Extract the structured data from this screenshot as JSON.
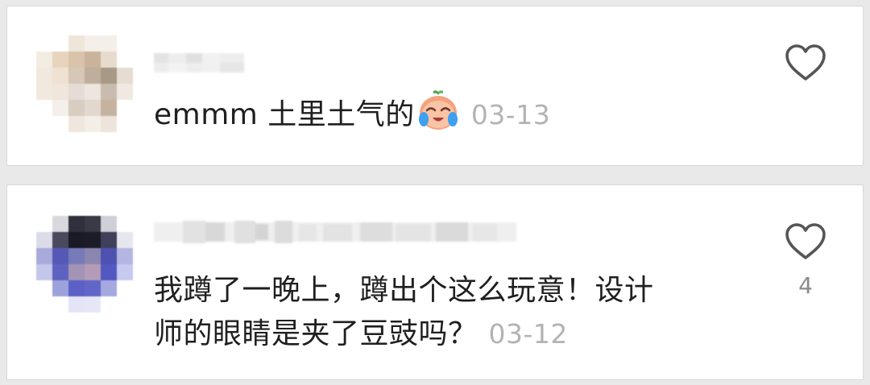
{
  "comments": [
    {
      "text": "emmm 土里土气的",
      "emoji": "crying-laughing-face-emoji",
      "date": "03-13",
      "like_count": ""
    },
    {
      "text_line1": "我蹲了一晚上，蹲出个这么玩意！设计",
      "text_line2": "师的眼睛是夹了豆豉吗？",
      "date": "03-12",
      "like_count": "4"
    }
  ],
  "icons": {
    "like": "heart-outline-icon"
  },
  "colors": {
    "text": "#1f1f1f",
    "date": "#b3b3b3",
    "icon": "#555555",
    "count": "#8a8a8a"
  }
}
